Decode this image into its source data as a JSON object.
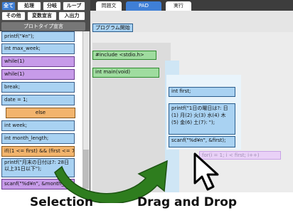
{
  "palette_tabs": {
    "all": "全て",
    "process": "処理",
    "branch": "分岐",
    "loop": "ループ",
    "other": "その他",
    "variable_decl": "変数宣言",
    "io": "入出力",
    "prototype": "プロトタイプ宣言"
  },
  "palette_blocks": [
    "printf(\"¥n\");",
    "int max_week;",
    "while(1)",
    "while(1)",
    "break;",
    "date = 1;",
    "else",
    "int week;",
    "int month_length;",
    "if((1 <= first) && (first <= 7))",
    "printf(\"月末の日付は?: 28日以上31日以下\");",
    "scanf(\"%d¥n\", &month_length);"
  ],
  "editor_tabs": {
    "pad_diagram": "問題文",
    "pad": "PAD",
    "run": "実行"
  },
  "editor": {
    "program_start": "プログラム開始",
    "include": "#include <stdio.h>",
    "main": "int main(void)",
    "decl_first": "int first;",
    "printf_prompt": "printf(\"1日の曜日は?: 日(1) 月(2) 火(3) 水(4) 木(5) 金(6) 土(7): \");",
    "scanf_first": "scanf(\"%d¥n\", &first);",
    "for_ghost": "for(i = 1; i < first; i++)"
  },
  "captions": {
    "selection": "Selection",
    "drag_and_drop": "Drag and Drop"
  },
  "colors": {
    "accent_blue": "#3f7fd6",
    "block_blue": "#a9d2f2",
    "block_purple": "#c79be9",
    "block_orange": "#f2b46d",
    "block_green": "#9fdc9f",
    "arrow_green": "#2e7d1e"
  },
  "icons": {
    "arrow": "curved-arrow-icon",
    "cursor": "mouse-pointer-icon"
  }
}
